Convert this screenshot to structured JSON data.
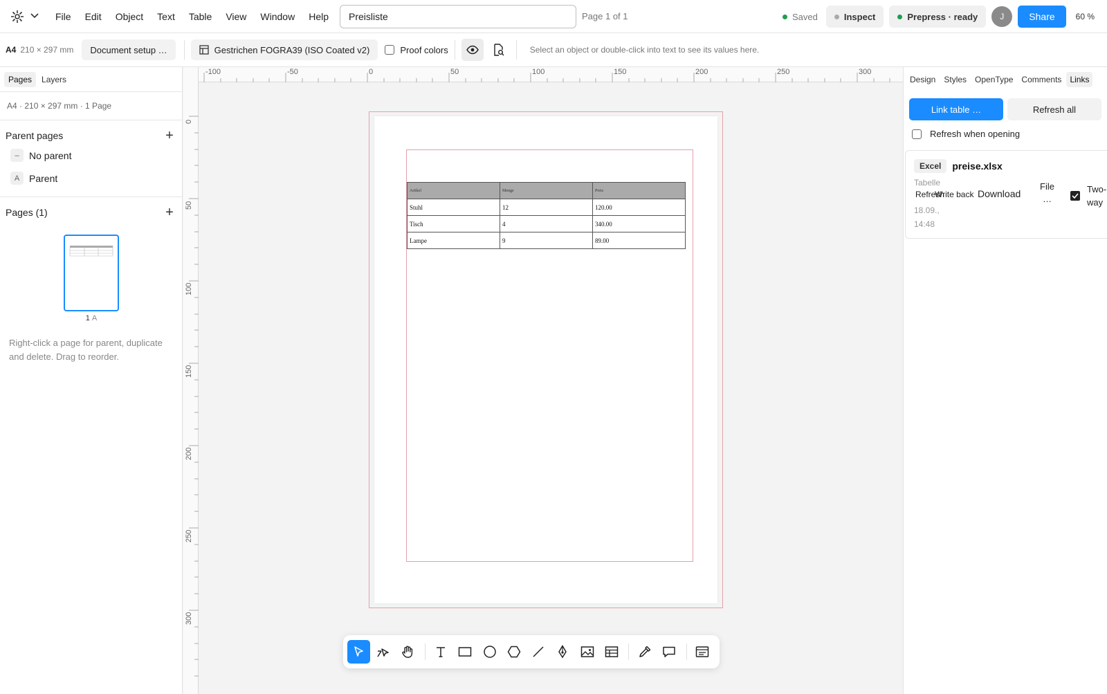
{
  "topbar": {
    "menu": [
      "File",
      "Edit",
      "Object",
      "Text",
      "Table",
      "View",
      "Window",
      "Help"
    ],
    "doc_title": "Preisliste",
    "page_of": "Page 1 of 1",
    "saved": "Saved",
    "inspect": "Inspect",
    "prepress": "Prepress · ready",
    "avatar": "J",
    "share": "Share",
    "zoom": "60 %"
  },
  "toolbar2": {
    "format": "A4",
    "format_size": "210 × 297 mm",
    "document_setup": "Document setup …",
    "profile": "Gestrichen FOGRA39 (ISO Coated v2)",
    "proof_colors": "Proof colors",
    "hint": "Select an object or double-click into text to see its values here."
  },
  "left_panel": {
    "tabs": [
      "Pages",
      "Layers"
    ],
    "meta": "A4 · 210 × 297 mm · 1 Page",
    "parent_pages_title": "Parent pages",
    "parents": [
      {
        "badge": "–",
        "label": "No parent"
      },
      {
        "badge": "A",
        "label": "Parent"
      }
    ],
    "pages_title": "Pages (1)",
    "page_number": "1",
    "page_parent": "A",
    "hint": "Right-click a page for parent, duplicate and delete. Drag to reorder."
  },
  "rulers": {
    "h": [
      "-100",
      "-50",
      "0",
      "50",
      "100",
      "150",
      "200",
      "250",
      "300"
    ],
    "v": [
      "0",
      "50",
      "100",
      "150",
      "200",
      "250",
      "300"
    ]
  },
  "table": {
    "headers": [
      "Artikel",
      "Menge",
      "Preis"
    ],
    "rows": [
      [
        "Stuhl",
        "12",
        "120.00"
      ],
      [
        "Tisch",
        "4",
        "340.00"
      ],
      [
        "Lampe",
        "9",
        "89.00"
      ]
    ]
  },
  "right_panel": {
    "tabs": [
      "Design",
      "Styles",
      "OpenType",
      "Comments",
      "Links"
    ],
    "link_table": "Link table …",
    "refresh_all": "Refresh all",
    "refresh_when_opening": "Refresh when opening",
    "link": {
      "type": "Excel",
      "file": "preise.xlsx",
      "sheet": "Tabelle",
      "date": "18.09.,",
      "time": "14:48",
      "refresh": "Refresh",
      "write_back": "Write back",
      "download": "Download",
      "file_menu": "File",
      "file_more": "…",
      "two_way": "Two-way"
    }
  },
  "colors": {
    "accent": "#1a8cff",
    "saved_dot": "#1e9e50",
    "inspect_dot": "#aaaaaa",
    "prepress_dot": "#1e9e50",
    "bleed": "#e3a0a8",
    "table_header": "#aaaaaa"
  }
}
